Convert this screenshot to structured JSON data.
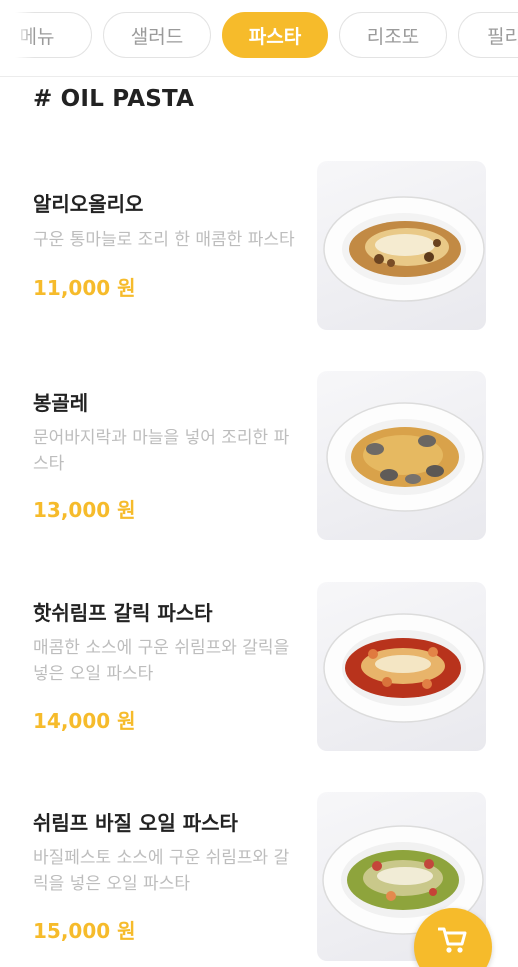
{
  "tabs": [
    {
      "label": "메뉴",
      "active": false
    },
    {
      "label": "샐러드",
      "active": false
    },
    {
      "label": "파스타",
      "active": true
    },
    {
      "label": "리조또",
      "active": false
    },
    {
      "label": "필리",
      "active": false
    }
  ],
  "section": {
    "title": "# OIL PASTA"
  },
  "items": [
    {
      "name": "알리오올리오",
      "desc": "구운 통마늘로 조리 한 매콤한 파스타",
      "price": "11,000 원"
    },
    {
      "name": "봉골레",
      "desc": "문어바지락과 마늘을 넣어 조리한 파스타",
      "price": "13,000 원"
    },
    {
      "name": "핫쉬림프 갈릭 파스타",
      "desc": "매콤한 소스에 구운 쉬림프와 갈릭을 넣은 오일 파스타",
      "price": "14,000 원"
    },
    {
      "name": "쉬림프 바질 오일 파스타",
      "desc": "바질페스토 소스에 구운 쉬림프와 갈릭을 넣은 오일 파스타",
      "price": "15,000 원"
    }
  ],
  "colors": {
    "accent": "#f6bb2b",
    "desc": "#bdbdbd",
    "text": "#222222"
  },
  "cart": {
    "icon": "cart-icon"
  }
}
